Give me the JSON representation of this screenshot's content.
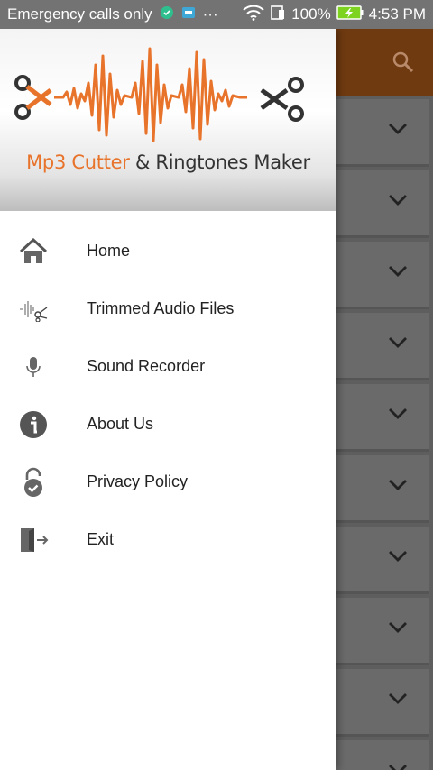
{
  "statusbar": {
    "carrier": "Emergency calls only",
    "dots": "···",
    "battery_pct": "100%",
    "time": "4:53 PM"
  },
  "banner": {
    "title_part1": "Mp3 Cutter",
    "title_part2": " & Ringtones Maker",
    "accent_color": "#e8732b"
  },
  "menu": {
    "items": [
      {
        "label": "Home",
        "icon": "home-icon"
      },
      {
        "label": "Trimmed Audio Files",
        "icon": "trimmed-audio-icon"
      },
      {
        "label": "Sound Recorder",
        "icon": "microphone-icon"
      },
      {
        "label": "About Us",
        "icon": "info-icon"
      },
      {
        "label": "Privacy Policy",
        "icon": "padlock-icon"
      },
      {
        "label": "Exit",
        "icon": "exit-door-icon"
      }
    ]
  },
  "colors": {
    "toolbar": "#6f3a10",
    "scrim": "#5e5e5e"
  }
}
